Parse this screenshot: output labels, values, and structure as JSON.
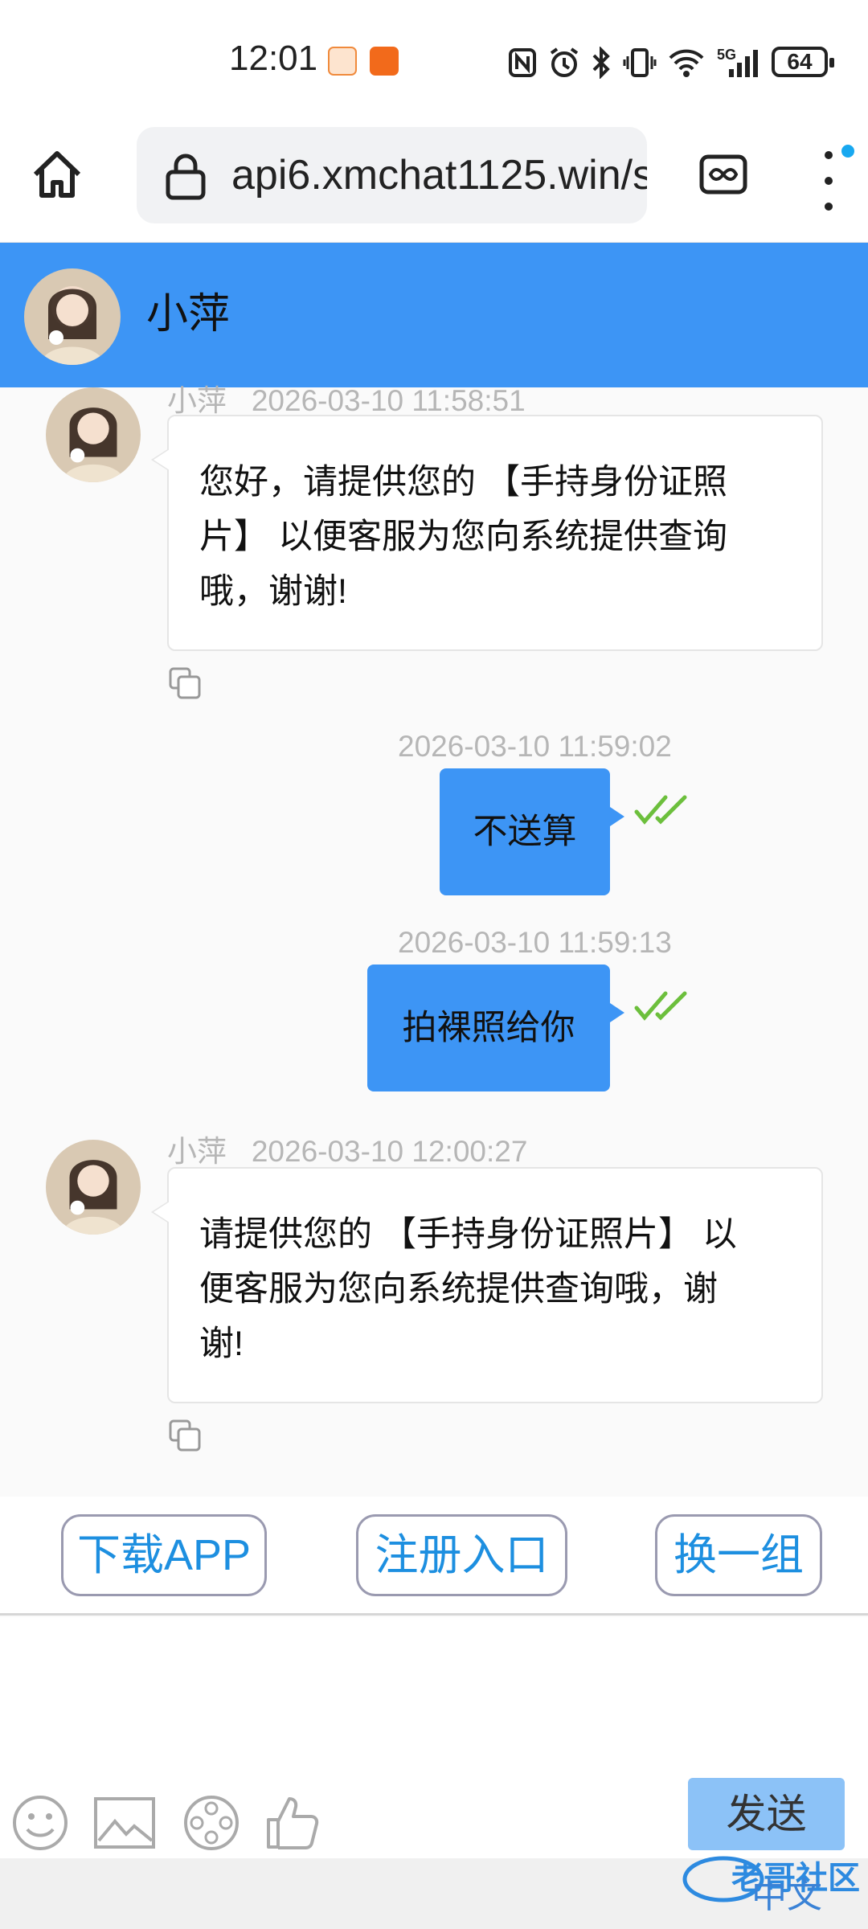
{
  "status_bar": {
    "time": "12:01",
    "network": "5G",
    "battery": "64"
  },
  "browser": {
    "url": "api6.xmchat1125.win/s"
  },
  "chat": {
    "contact_name": "小萍",
    "messages": [
      {
        "direction": "incoming",
        "sender": "小萍",
        "timestamp": "2026-03-10 11:58:51",
        "lines": [
          "您好，请提供您的 【手持身份证照",
          "片】 以便客服为您向系统提供查询",
          "哦，谢谢!"
        ]
      },
      {
        "direction": "outgoing",
        "timestamp": "2026-03-10 11:59:02",
        "text": "不送算",
        "status": "read"
      },
      {
        "direction": "outgoing",
        "timestamp": "2026-03-10 11:59:13",
        "text": "拍裸照给你",
        "status": "read"
      },
      {
        "direction": "incoming",
        "sender": "小萍",
        "timestamp": "2026-03-10 12:00:27",
        "lines": [
          "请提供您的 【手持身份证照片】 以",
          "便客服为您向系统提供查询哦，谢",
          "谢!"
        ]
      }
    ]
  },
  "quick_actions": {
    "download_app": "下载APP",
    "register": "注册入口",
    "switch_group": "换一组"
  },
  "composer": {
    "send_label": "发送",
    "tools": [
      "emoji-icon",
      "image-icon",
      "video-icon",
      "like-icon"
    ]
  },
  "footer": {
    "language": "中文",
    "watermark": "老哥社区"
  },
  "colors": {
    "accent": "#3d95f5",
    "quick_text": "#1d8fe0",
    "check": "#6cbf3c",
    "send_button": "#8cc2f7"
  }
}
